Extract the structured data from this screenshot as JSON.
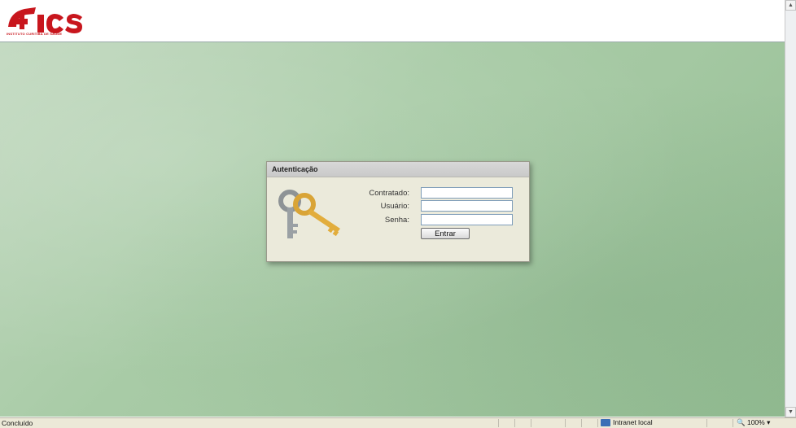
{
  "header": {
    "logo_alt": "ICS",
    "logo_subtitle": "INSTITUTO CURITIBA DE SAÚDE"
  },
  "login": {
    "title": "Autenticação",
    "fields": {
      "contratado": {
        "label": "Contratado:",
        "value": ""
      },
      "usuario": {
        "label": "Usuário:",
        "value": ""
      },
      "senha": {
        "label": "Senha:",
        "value": ""
      }
    },
    "submit_label": "Entrar"
  },
  "statusbar": {
    "status_text": "Concluído",
    "zone_label": "Intranet local",
    "zoom_label": "100%"
  },
  "icons": {
    "keys": "keys-icon",
    "zone": "intranet-icon",
    "zoom": "magnifier-icon"
  },
  "colors": {
    "brand_red": "#c8161d",
    "background_green": "#a8cba6",
    "panel_bg": "#ebeadb"
  }
}
